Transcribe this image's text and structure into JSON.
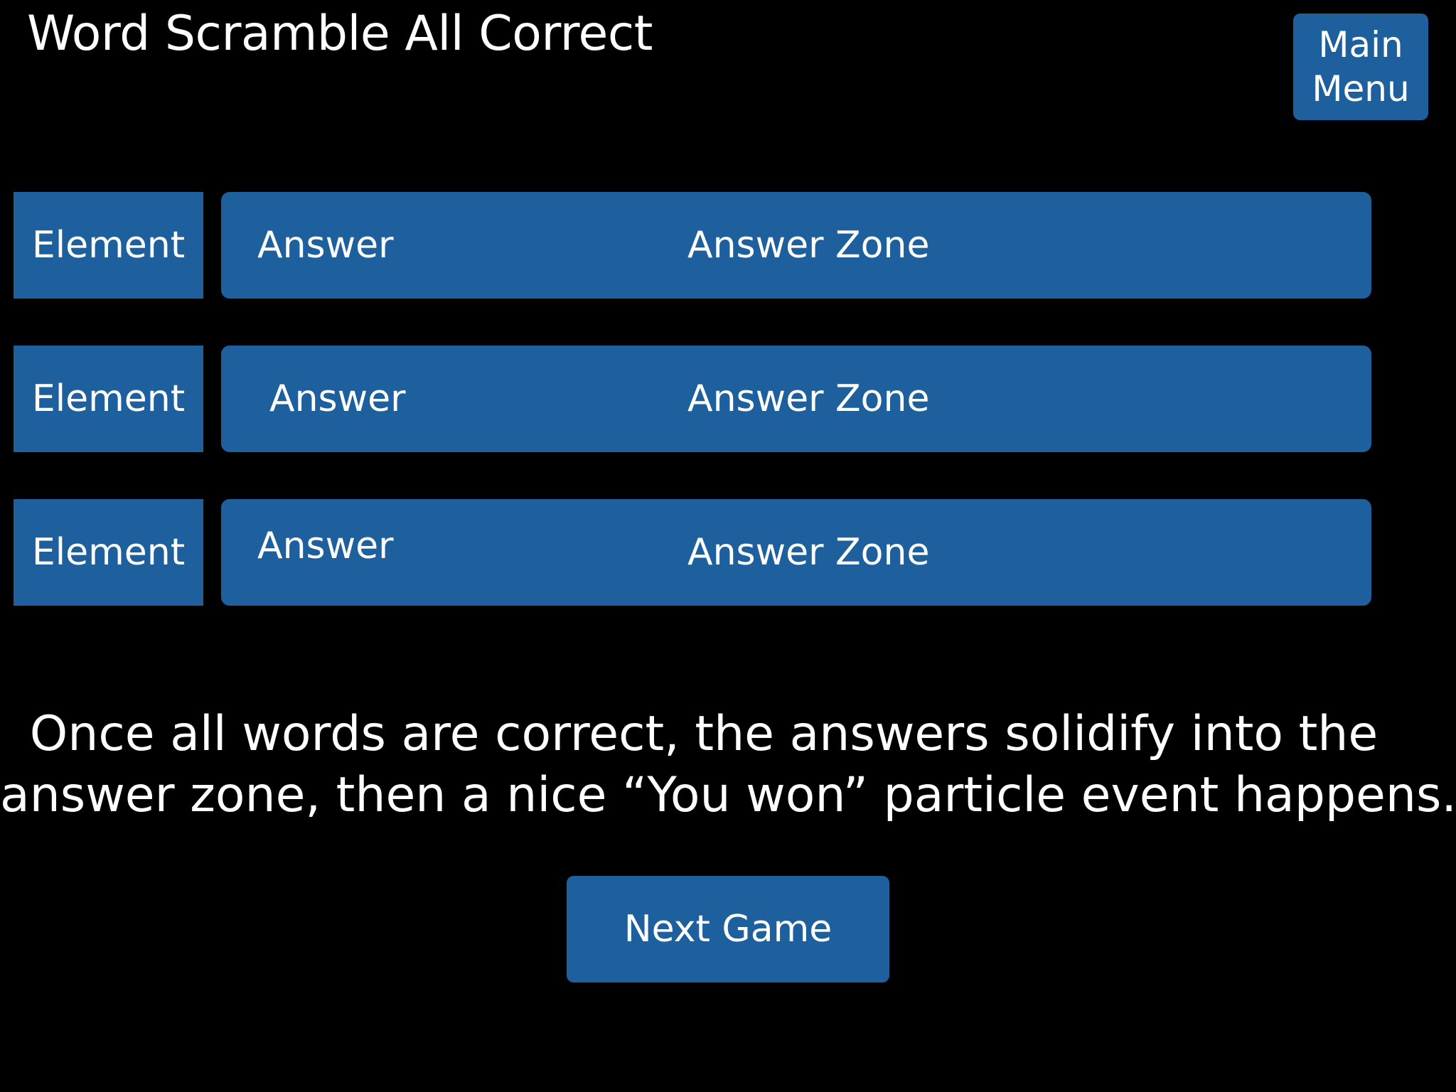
{
  "header": {
    "title": "Word Scramble All Correct",
    "main_menu_line1": "Main",
    "main_menu_line2": "Menu"
  },
  "rows": [
    {
      "element": "Element",
      "answer": "Answer",
      "zone_label": "Answer Zone"
    },
    {
      "element": "Element",
      "answer": "Answer",
      "zone_label": "Answer Zone"
    },
    {
      "element": "Element",
      "answer": "Answer",
      "zone_label": "Answer Zone"
    }
  ],
  "message": {
    "line1": "Once all words are correct, the answers solidify into the",
    "line2": "answer zone, then a nice “You won” particle event happens."
  },
  "footer": {
    "next_game_label": "Next Game"
  },
  "colors": {
    "background": "#000000",
    "tile": "#1e609e",
    "text": "#ffffff"
  }
}
